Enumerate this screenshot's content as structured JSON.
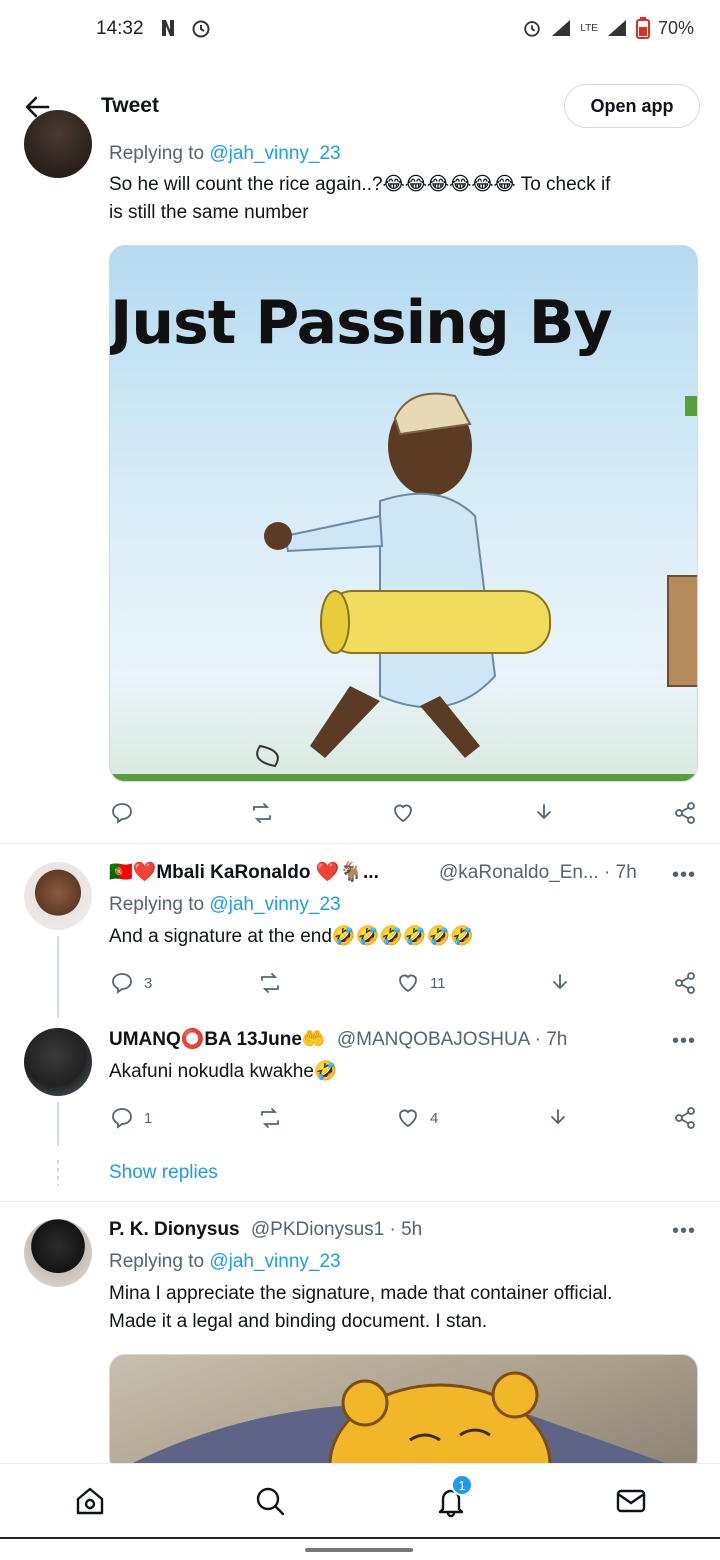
{
  "status_bar": {
    "time": "14:32",
    "battery": "70%",
    "network": "LTE"
  },
  "header": {
    "title": "Tweet",
    "open_app": "Open app"
  },
  "tweets": [
    {
      "reply_prefix": "Replying to ",
      "reply_to": "@jah_vinny_23",
      "text_line1": "So he will count the rice again..?😂😂😂😂😂😂 To check if",
      "text_line2": "is still the same number",
      "image_caption": "Just Passing By"
    },
    {
      "name": "🇵🇹❤️Mbali KaRonaldo ❤️🐐...",
      "handle": "@kaRonaldo_En... · 7h",
      "reply_prefix": "Replying to ",
      "reply_to": "@jah_vinny_23",
      "text": "And a signature at the end🤣🤣🤣🤣🤣🤣",
      "replies": "3",
      "likes": "11"
    },
    {
      "name": "UMANQ⭕BA 13June🤲",
      "handle": "@MANQOBAJOSHUA · 7h",
      "text": "Akafuni nokudla kwakhe🤣",
      "replies": "1",
      "likes": "4"
    },
    {
      "name": "P. K. Dionysus",
      "handle": "@PKDionysus1 · 5h",
      "reply_prefix": "Replying to ",
      "reply_to": "@jah_vinny_23",
      "text_line1": "Mina I appreciate the signature, made that container official.",
      "text_line2": "Made it a legal and binding document. I stan."
    }
  ],
  "show_replies": "Show replies",
  "more": "•••",
  "nav": {
    "notification_count": "1"
  },
  "colors": {
    "accent": "#1d9bf0",
    "text": "#0f1419",
    "muted": "#536471"
  }
}
